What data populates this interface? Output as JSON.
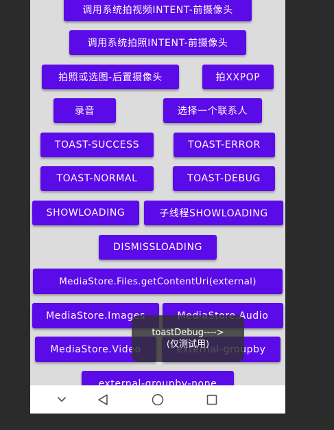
{
  "buttons": [
    {
      "name": "system-video-intent-front-camera-button",
      "label": "调用系统拍视频INTENT-前摄像头"
    },
    {
      "name": "system-photo-intent-front-camera-button",
      "label": "调用系统拍照INTENT-前摄像头"
    },
    {
      "name": "photo-or-pick-rear-camera-button",
      "label": "拍照或选图-后置摄像头"
    },
    {
      "name": "xxpop-button",
      "label": "拍XXPOP"
    },
    {
      "name": "record-audio-button",
      "label": "录音"
    },
    {
      "name": "pick-contact-button",
      "label": "选择一个联系人"
    },
    {
      "name": "toast-success-button",
      "label": "TOAST-SUCCESS"
    },
    {
      "name": "toast-error-button",
      "label": "TOAST-ERROR"
    },
    {
      "name": "toast-normal-button",
      "label": "TOAST-NORMAL"
    },
    {
      "name": "toast-debug-button",
      "label": "TOAST-DEBUG"
    },
    {
      "name": "show-loading-button",
      "label": "SHOWLOADING"
    },
    {
      "name": "subthread-show-loading-button",
      "label": "子线程SHOWLOADING"
    },
    {
      "name": "dismiss-loading-button",
      "label": "DISMISSLOADING"
    },
    {
      "name": "mediastore-files-external-button",
      "label": "MediaStore.Files.getContentUri(external)"
    },
    {
      "name": "mediastore-images-button",
      "label": "MediaStore.Images"
    },
    {
      "name": "mediastore-audio-button",
      "label": "MediaStore.Audio"
    },
    {
      "name": "mediastore-video-button",
      "label": "MediaStore.Video"
    },
    {
      "name": "external-groupby-button",
      "label": "external-groupby"
    },
    {
      "name": "external-groupby-none-button",
      "label": "external-groupby-none"
    }
  ],
  "toast": {
    "line1": "toastDebug---->",
    "line2": "(仅测试用)"
  },
  "nav": {
    "icons": [
      "chevron-down-icon",
      "back-triangle-icon",
      "home-circle-icon",
      "recents-square-icon"
    ]
  },
  "colors": {
    "button": "#5b0ae8",
    "screen_background": "#dcdcdc",
    "outer_background": "#2b2b2b"
  }
}
